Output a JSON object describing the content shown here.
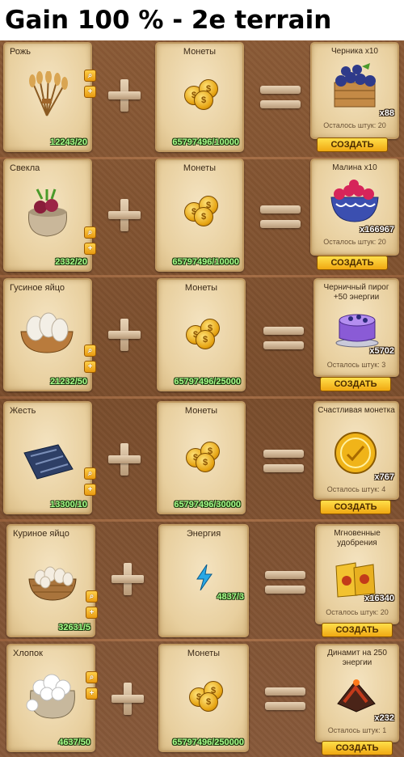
{
  "header": {
    "title": "Gain 100 % - 2e terrain"
  },
  "recipes": [
    {
      "ingredient": {
        "name": "Рожь",
        "count": "12243/20",
        "icon": "rye-sheaf-icon"
      },
      "resource": {
        "name": "Монеты",
        "count": "65797496/10000",
        "icon": "coins-icon"
      },
      "output": {
        "name": "Черника x10",
        "stock": "x88",
        "remaining": "Осталось штук: 20",
        "icon": "blueberries-crate-icon"
      },
      "create_label": "СОЗДАТЬ"
    },
    {
      "ingredient": {
        "name": "Свекла",
        "count": "2332/20",
        "icon": "beet-sack-icon"
      },
      "resource": {
        "name": "Монеты",
        "count": "65797496/10000",
        "icon": "coins-icon"
      },
      "output": {
        "name": "Малина x10",
        "stock": "x166967",
        "remaining": "Осталось штук: 20",
        "icon": "raspberries-bowl-icon"
      },
      "create_label": "СОЗДАТЬ"
    },
    {
      "ingredient": {
        "name": "Гусиное яйцо",
        "count": "21232/50",
        "icon": "goose-eggs-icon"
      },
      "resource": {
        "name": "Монеты",
        "count": "65797496/25000",
        "icon": "coins-icon"
      },
      "output": {
        "name": "Черничный пирог +50 энергии",
        "stock": "x5702",
        "remaining": "Осталось штук: 3",
        "icon": "blueberry-cake-icon"
      },
      "create_label": "СОЗДАТЬ"
    },
    {
      "ingredient": {
        "name": "Жесть",
        "count": "13300/10",
        "icon": "tin-sheet-icon"
      },
      "resource": {
        "name": "Монеты",
        "count": "65797496/30000",
        "icon": "coins-icon"
      },
      "output": {
        "name": "Счастливая монетка",
        "stock": "x767",
        "remaining": "Осталось штук: 4",
        "icon": "lucky-coin-icon"
      },
      "create_label": "СОЗДАТЬ"
    },
    {
      "ingredient": {
        "name": "Куриное яйцо",
        "count": "32631/5",
        "icon": "chicken-eggs-basket-icon"
      },
      "resource": {
        "name": "Энергия",
        "count": "4837/3",
        "icon": "lightning-icon"
      },
      "output": {
        "name": "Мгновенные удобрения",
        "stock": "x16340",
        "remaining": "Осталось штук: 20",
        "icon": "fertilizer-bags-icon"
      },
      "create_label": "СОЗДАТЬ"
    },
    {
      "ingredient": {
        "name": "Хлопок",
        "count": "4637/50",
        "icon": "cotton-sack-icon"
      },
      "resource": {
        "name": "Монеты",
        "count": "65797496/250000",
        "icon": "coins-icon"
      },
      "output": {
        "name": "Динамит на 250 энергии",
        "stock": "x232",
        "remaining": "Осталось штук: 1",
        "icon": "dynamite-icon"
      },
      "create_label": "СОЗДАТЬ"
    }
  ],
  "side_buttons": {
    "search_icon": "magnifier-icon",
    "add_icon": "plus-icon"
  }
}
